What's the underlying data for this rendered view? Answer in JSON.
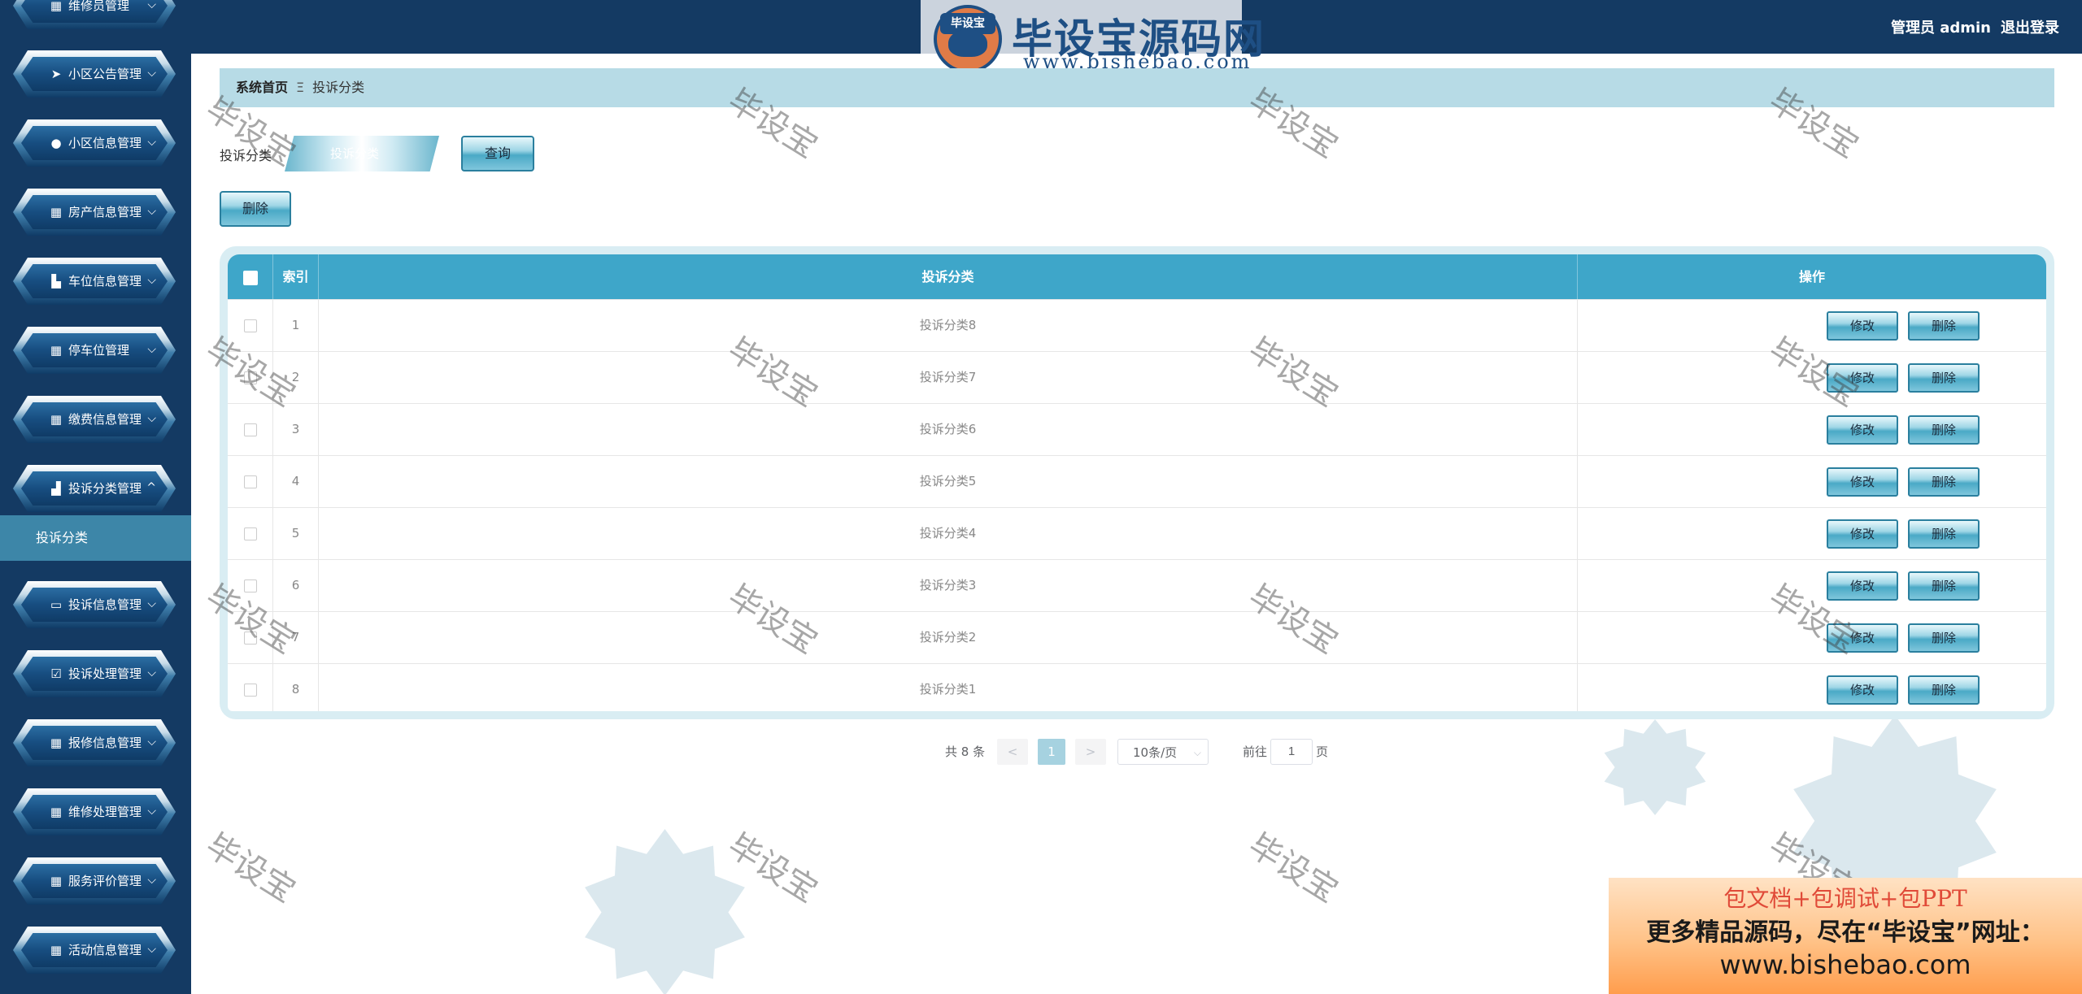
{
  "sidebar": {
    "menu": [
      {
        "label": "维修员管理",
        "icon": "grid-icon"
      },
      {
        "label": "小区公告管理",
        "icon": "paper-plane-icon"
      },
      {
        "label": "小区信息管理",
        "icon": "lightbulb-icon"
      },
      {
        "label": "房产信息管理",
        "icon": "grid-icon"
      },
      {
        "label": "车位信息管理",
        "icon": "building-icon"
      },
      {
        "label": "停车位管理",
        "icon": "grid-icon"
      },
      {
        "label": "缴费信息管理",
        "icon": "grid-icon"
      },
      {
        "label": "投诉分类管理",
        "icon": "bar-chart-icon"
      },
      {
        "label": "投诉信息管理",
        "icon": "monitor-icon"
      },
      {
        "label": "投诉处理管理",
        "icon": "clipboard-check-icon"
      },
      {
        "label": "报修信息管理",
        "icon": "grid-icon"
      },
      {
        "label": "维修处理管理",
        "icon": "grid-icon"
      },
      {
        "label": "服务评价管理",
        "icon": "grid-icon"
      },
      {
        "label": "活动信息管理",
        "icon": "grid-icon"
      }
    ],
    "submenu_active": "投诉分类"
  },
  "header": {
    "user": "管理员 admin",
    "logout": "退出登录"
  },
  "watermark_logo": {
    "tag": "毕设宝",
    "title": "毕设宝源码网",
    "url": "www.bishebao.com"
  },
  "breadcrumb": {
    "home": "系统首页",
    "separator": "Ξ",
    "current": "投诉分类"
  },
  "search": {
    "label": "投诉分类",
    "placeholder": "投诉分类",
    "query_button": "查询",
    "delete_button": "删除"
  },
  "table": {
    "headers": {
      "index": "索引",
      "name": "投诉分类",
      "action": "操作"
    },
    "edit_label": "修改",
    "delete_label": "删除",
    "rows": [
      {
        "index": "1",
        "name": "投诉分类8"
      },
      {
        "index": "2",
        "name": "投诉分类7"
      },
      {
        "index": "3",
        "name": "投诉分类6"
      },
      {
        "index": "4",
        "name": "投诉分类5"
      },
      {
        "index": "5",
        "name": "投诉分类4"
      },
      {
        "index": "6",
        "name": "投诉分类3"
      },
      {
        "index": "7",
        "name": "投诉分类2"
      },
      {
        "index": "8",
        "name": "投诉分类1"
      }
    ]
  },
  "pagination": {
    "total": "共 8 条",
    "prev": "<",
    "current_page": "1",
    "next": ">",
    "page_size": "10条/页",
    "goto_label": "前往",
    "goto_value": "1",
    "unit": "页"
  },
  "watermark_text": "毕设宝",
  "promo": {
    "line1": "包文档+包调试+包PPT",
    "line2": "更多精品源码，尽在“毕设宝”网址：",
    "line3": "www.bishebao.com"
  },
  "colors": {
    "sidebar_bg": "#143a63",
    "header_bg": "#143a63",
    "breadcrumb_bg": "#b7dbe6",
    "table_header_bg": "#3ea6c9",
    "submenu_active_bg": "#3d86a8"
  }
}
